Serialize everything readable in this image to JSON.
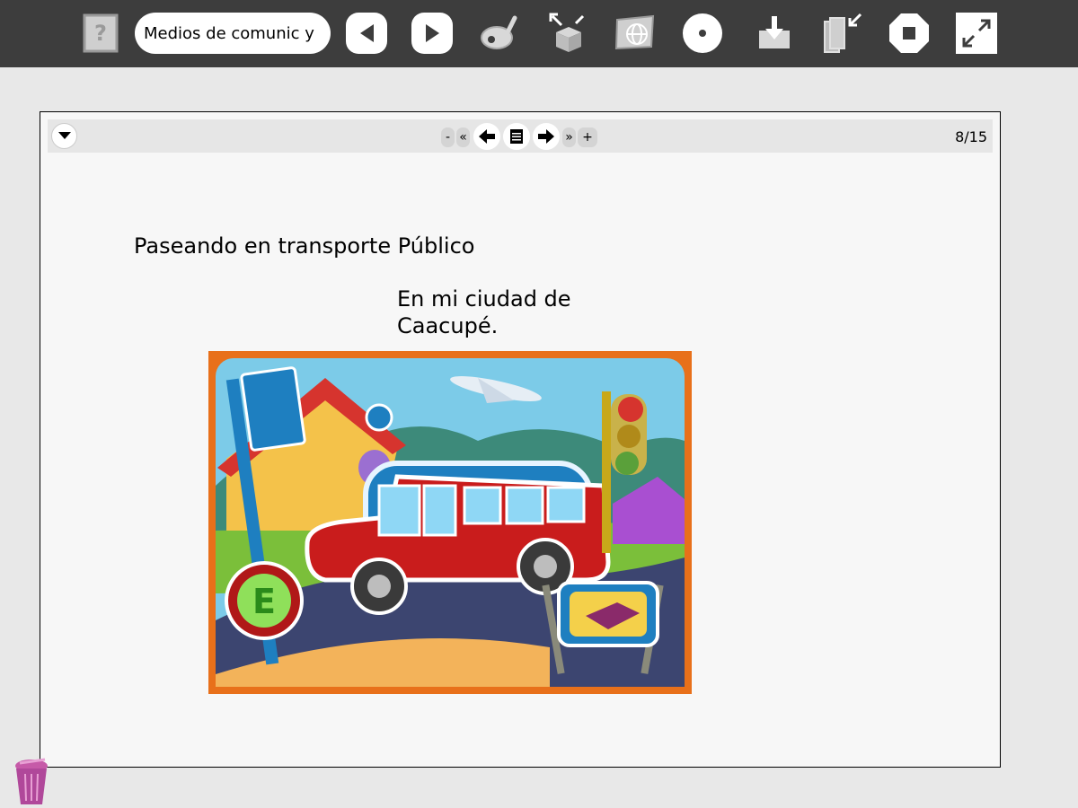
{
  "toolbar": {
    "activity_title": "Medios de comunic y",
    "buttons": [
      {
        "name": "help-icon",
        "label": "?"
      },
      {
        "name": "back-icon"
      },
      {
        "name": "forward-icon"
      },
      {
        "name": "paint-icon"
      },
      {
        "name": "share-box-icon"
      },
      {
        "name": "web-map-icon"
      },
      {
        "name": "record-icon"
      },
      {
        "name": "download-icon"
      },
      {
        "name": "journal-import-icon"
      },
      {
        "name": "stop-icon"
      },
      {
        "name": "fullscreen-icon"
      }
    ]
  },
  "slides": {
    "minus_label": "-",
    "first_label": "«",
    "last_label": "»",
    "plus_label": "+",
    "page_counter": "8/15"
  },
  "slide": {
    "title": "Paseando en transporte Público",
    "subtitle_line1": "En mi ciudad de",
    "subtitle_line2": "Caacupé."
  },
  "colors": {
    "toolbar_bg": "#3d3d3d",
    "canvas_bg": "#f7f7f7",
    "bus_red": "#c91c1c",
    "bus_blue": "#1e7fc0",
    "trash_purple": "#b0489a"
  }
}
